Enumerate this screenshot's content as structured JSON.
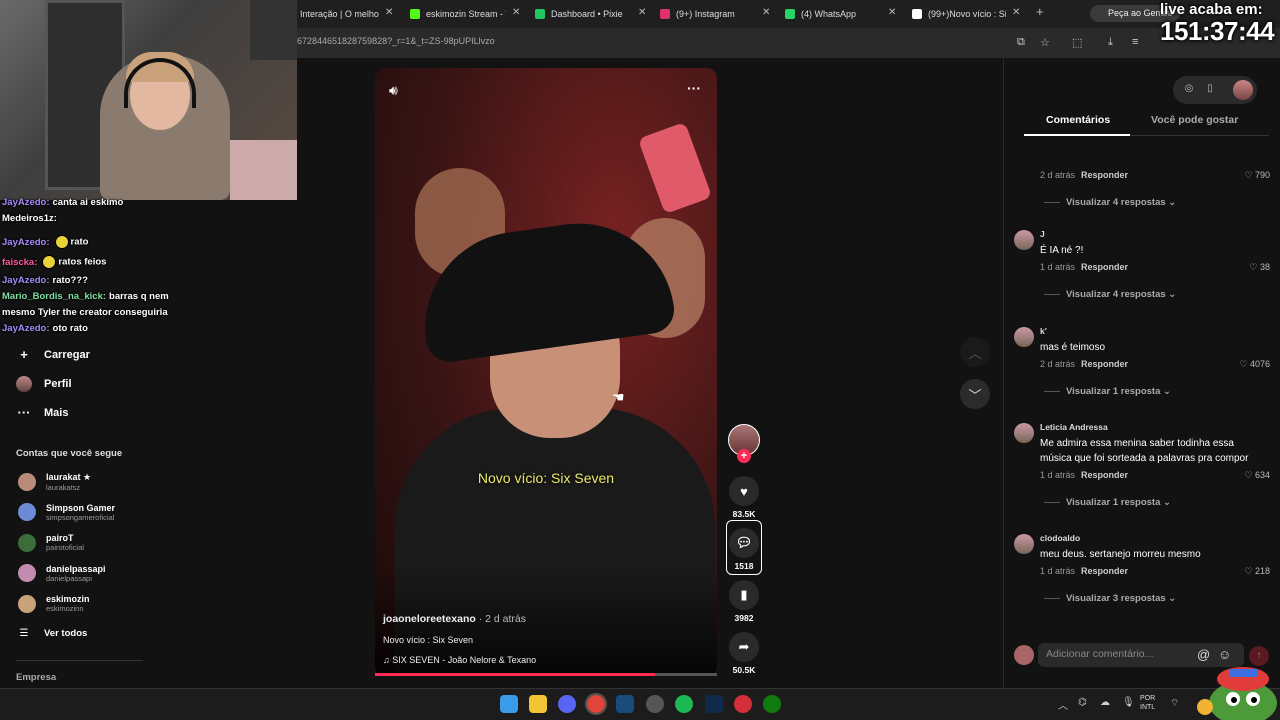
{
  "stream": {
    "timer_title": "live acaba em:",
    "timer": "151:37:44",
    "chat": [
      {
        "user": "JayAzedo:",
        "color": "#a78bfa",
        "text": "canta ai eskimo",
        "emote": false
      },
      {
        "user": "Medeiros1z:",
        "color": "#ffffff",
        "text": "",
        "emote": false
      },
      {
        "user": "JayAzedo:",
        "color": "#a78bfa",
        "text": "rato",
        "emote": true
      },
      {
        "user": "faiscka:",
        "color": "#ff5aa0",
        "text": "ratos feios",
        "emote": true
      },
      {
        "user": "JayAzedo:",
        "color": "#a78bfa",
        "text": "rato???",
        "emote": false
      },
      {
        "user": "Mario_Bordis_na_kick:",
        "color": "#7ee0a0",
        "text": "barras q nem",
        "emote": false
      },
      {
        "user": "",
        "color": "#ffffff",
        "text": "mesmo Tyler the creator conseguiria",
        "emote": false
      },
      {
        "user": "JayAzedo:",
        "color": "#a78bfa",
        "text": "oto rato",
        "emote": false
      }
    ]
  },
  "browser": {
    "tabs": [
      {
        "label": "Interação | O melhor",
        "color": "#3b82f6"
      },
      {
        "label": "eskimozin Stream - W",
        "color": "#53fc18"
      },
      {
        "label": "Dashboard • Pixie",
        "color": "#22c55e"
      },
      {
        "label": "(9+) Instagram",
        "color": "#e1306c"
      },
      {
        "label": "(4) WhatsApp",
        "color": "#25d366"
      },
      {
        "label": "(99+)Novo vício : Six S",
        "color": "#ffffff"
      }
    ],
    "new_tab": "+",
    "gemini": "Peça ao Gemini",
    "url": "6728446518287598​28?_r=1&_t=ZS-98pUPILlvzo"
  },
  "sidebar": {
    "items": [
      {
        "label": "Carregar",
        "icon": "+"
      },
      {
        "label": "Perfil",
        "icon": "avatar"
      },
      {
        "label": "Mais",
        "icon": "···"
      }
    ],
    "follow_title": "Contas que você segue",
    "accounts": [
      {
        "name": "laurakat ★",
        "handle": "laurakatsz",
        "color": "#b98c7a"
      },
      {
        "name": "Simpson Gamer",
        "handle": "simpsongameroficial",
        "color": "#6b8bd6"
      },
      {
        "name": "pairoT",
        "handle": "pairotoficial",
        "color": "#3a6d3a"
      },
      {
        "name": "danielpassapi",
        "handle": "danielpassapi",
        "color": "#c28bb0"
      },
      {
        "name": "eskimozin",
        "handle": "eskimozinn",
        "color": "#c9a27c"
      }
    ],
    "see_all": "Ver todos",
    "company": "Empresa"
  },
  "video": {
    "caption_overlay": "Novo vício: Six Seven",
    "username": "joaoneloreetexano",
    "date": " · 2 d atrás",
    "description": "Novo vício : Six Seven",
    "music": "SIX SEVEN - João Nelore & Texano",
    "progress": 0.82
  },
  "actions": {
    "likes": "83.5K",
    "comments": "1518",
    "saves": "3982",
    "shares": "50.5K"
  },
  "comments_panel": {
    "tab_comments": "Comentários",
    "tab_like": "Você pode gostar",
    "first_meta": {
      "time": "2 d atrás",
      "reply": "Responder",
      "likes": "790",
      "replies": "Visualizar 4 respostas"
    },
    "comments": [
      {
        "name": "J",
        "text": "É IA né ?!",
        "time": "1 d atrás",
        "reply": "Responder",
        "likes": "38",
        "replies": "Visualizar 4 respostas"
      },
      {
        "name": "k'",
        "text": "mas é teimoso",
        "time": "2 d atrás",
        "reply": "Responder",
        "likes": "4076",
        "replies": "Visualizar 1 resposta"
      },
      {
        "name": "Leticia Andressa",
        "text": "Me admira essa menina saber todinha essa música que foi sorteada a palavras pra compor",
        "time": "1 d atrás",
        "reply": "Responder",
        "likes": "634",
        "replies": "Visualizar 1 resposta"
      },
      {
        "name": "clodoaldo",
        "text": "meu deus. sertanejo morreu mesmo",
        "time": "1 d atrás",
        "reply": "Responder",
        "likes": "218",
        "replies": "Visualizar 3 respostas"
      }
    ],
    "add_placeholder": "Adicionar comentário..."
  },
  "taskbar": {
    "lang_top": "POR",
    "lang_bottom": "INTL"
  }
}
